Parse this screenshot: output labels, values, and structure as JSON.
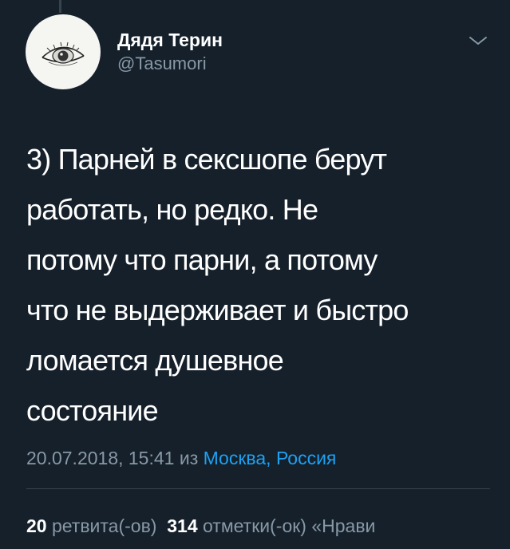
{
  "tweet": {
    "author": {
      "display_name": "Дядя Терин",
      "handle": "@Tasumori"
    },
    "text_lines": [
      "3) Парней в сексшопе берут",
      "работать, но редко. Не",
      "потому что парни, а потому",
      "что не выдерживает и быстро",
      "ломается душевное",
      "состояние"
    ],
    "timestamp": "20.07.2018, 15:41",
    "from_label": "из",
    "location": "Москва, Россия",
    "stats": {
      "retweets_count": "20",
      "retweets_label": "ретвита(-ов)",
      "likes_count": "314",
      "likes_label": "отметки(-ок)",
      "quotes_label": "«Нрави"
    }
  },
  "colors": {
    "background": "#15202b",
    "primary_text": "#ffffff",
    "secondary_text": "#8899a6",
    "link": "#1da1f2",
    "divider": "#38444d"
  },
  "icons": {
    "avatar": "sketched-eye-avatar",
    "caret": "chevron-down-icon"
  }
}
